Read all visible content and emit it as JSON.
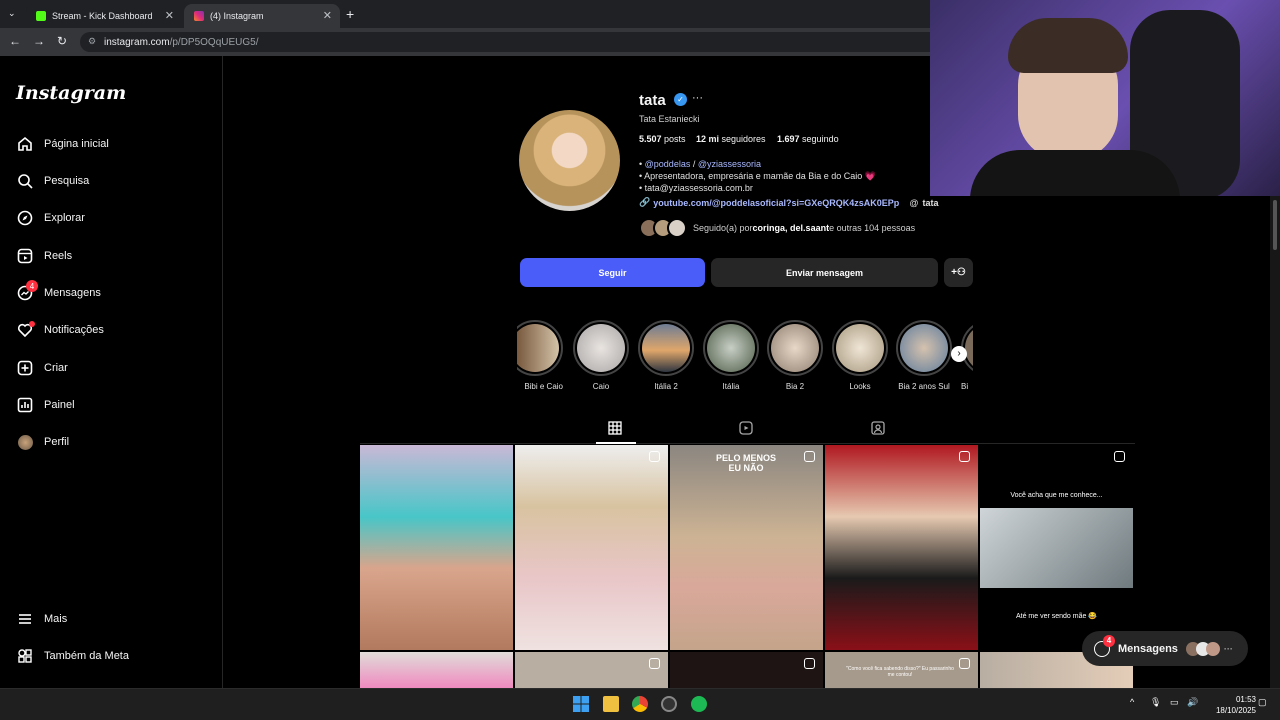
{
  "browser": {
    "tabs": [
      {
        "title": "Stream - Kick Dashboard"
      },
      {
        "title": "(4) Instagram"
      }
    ],
    "url_host": "instagram.com",
    "url_path": "/p/DP5OQqUEUG5/"
  },
  "sidebar": {
    "logo": "Instagram",
    "items": [
      {
        "label": "Página inicial"
      },
      {
        "label": "Pesquisa"
      },
      {
        "label": "Explorar"
      },
      {
        "label": "Reels"
      },
      {
        "label": "Mensagens",
        "badge": "4"
      },
      {
        "label": "Notificações"
      },
      {
        "label": "Criar"
      },
      {
        "label": "Painel"
      },
      {
        "label": "Perfil"
      }
    ],
    "more": "Mais",
    "meta": "Também da Meta"
  },
  "profile": {
    "username": "tata",
    "full_name": "Tata Estaniecki",
    "posts": "5.507",
    "posts_label": "posts",
    "followers": "12 mi",
    "followers_label": "seguidores",
    "following": "1.697",
    "following_label": "seguindo",
    "bio_mention_1": "@poddelas",
    "bio_sep": " / ",
    "bio_mention_2": "@yziassessoria",
    "bio_line_2": "• Apresentadora, empresária e mamãe da Bia e do Caio 💗",
    "bio_line_3": "• tata@yziassessoria.com.br",
    "link": "youtube.com/@poddelasoficial?si=GXeQRQK4zsAK0EPp",
    "threads": "tata",
    "followed_prefix": "Seguido(a) por ",
    "followed_names": "coringa, del.saant",
    "followed_suffix": " e outras 104 pessoas",
    "follow_button": "Seguir",
    "message_button": "Enviar mensagem"
  },
  "highlights": [
    {
      "label": "Bibi e Caio"
    },
    {
      "label": "Caio"
    },
    {
      "label": "Itália 2"
    },
    {
      "label": "Itália"
    },
    {
      "label": "Bia 2"
    },
    {
      "label": "Looks"
    },
    {
      "label": "Bia 2 anos Sul"
    },
    {
      "label": "Bi"
    }
  ],
  "grid": {
    "post3_caption": "PELO MENOS EU NÃO",
    "post5_top": "Você acha que me conhece...",
    "post5_bottom": "Até me ver sendo mãe 😂",
    "post9_caption": "\"Como você fica sabendo disso?\" Eu passarinho me contou!"
  },
  "messages_pill": {
    "label": "Mensagens",
    "badge": "4"
  },
  "taskbar": {
    "time": "01:53",
    "date": "18/10/2025"
  },
  "colors": {
    "accent": "#4a5df9",
    "verified": "#3897f0",
    "badge": "#ff3040"
  }
}
